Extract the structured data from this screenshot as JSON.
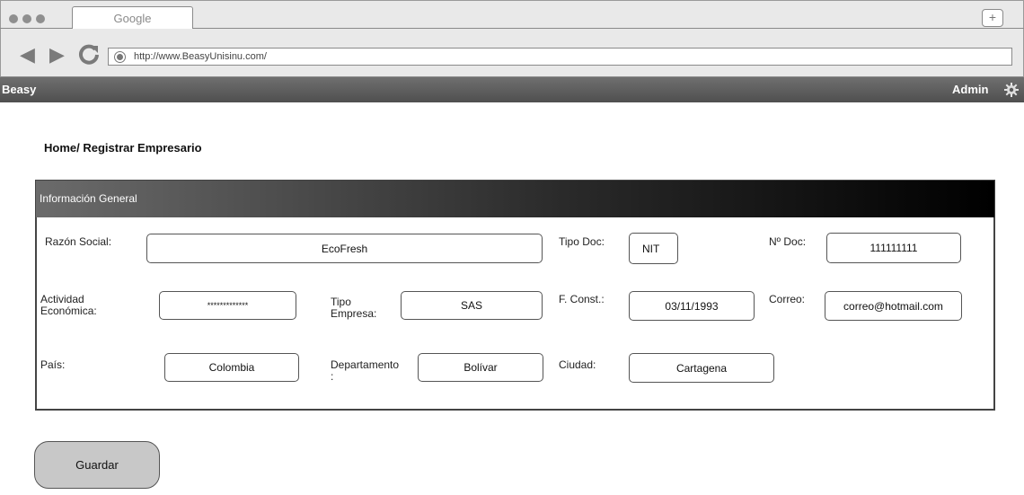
{
  "browser": {
    "tab_title": "Google",
    "new_tab_label": "+",
    "url": "http://www.BeasyUnisinu.com/"
  },
  "appbar": {
    "brand": "Beasy",
    "user": "Admin",
    "settings_icon": "gear-icon"
  },
  "breadcrumb": "Home/ Registrar Empresario",
  "panel": {
    "header": "Información General",
    "labels": {
      "razon_social": "Razón Social:",
      "tipo_doc": "Tipo Doc:",
      "n_doc": "Nº Doc:",
      "actividad_l1": "Actividad",
      "actividad_l2": "Económica:",
      "tipo_empresa_l1": "Tipo",
      "tipo_empresa_l2": "Empresa:",
      "f_const": "F. Const.:",
      "correo": "Correo:",
      "pais": "País:",
      "departamento_l1": "Departamento",
      "departamento_l2": ":",
      "ciudad": "Ciudad:"
    },
    "values": {
      "razon_social": "EcoFresh",
      "tipo_doc": "NIT",
      "n_doc": "111111111",
      "actividad": "*************",
      "tipo_empresa": "SAS",
      "f_const": "03/11/1993",
      "correo": "correo@hotmail.com",
      "pais": "Colombia",
      "departamento": "Bolívar",
      "ciudad": "Cartagena"
    }
  },
  "save_label": "Guardar",
  "colors": {
    "appbar": "#5f5f5f",
    "panel_header_start": "#6b6b6b",
    "panel_header_end": "#000000",
    "button": "#c8c8c8"
  }
}
